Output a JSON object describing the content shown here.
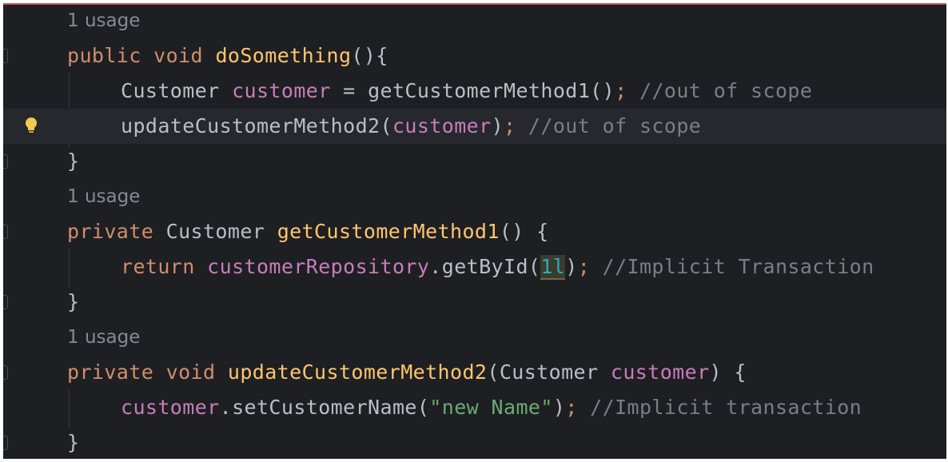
{
  "usages": [
    "1 usage",
    "1 usage",
    "1 usage"
  ],
  "method1": {
    "signature": {
      "kw1": "public",
      "kw2": "void",
      "name": "doSomething",
      "rest": "(){"
    },
    "line1": {
      "type": "Customer",
      "var": "customer",
      "op": " = ",
      "call": "getCustomerMethod1()",
      "semi": ";",
      "comment": "//out of scope"
    },
    "line2": {
      "call": "updateCustomerMethod2(",
      "arg": "customer",
      "close": ")",
      "semi": ";",
      "comment": "//out of scope"
    },
    "close": "}"
  },
  "method2": {
    "signature": {
      "kw1": "private",
      "type": "Customer",
      "name": "getCustomerMethod1",
      "rest": "() {"
    },
    "line1": {
      "kw": "return",
      "field": "customerRepository",
      "call": ".getById(",
      "num": "1l",
      "close": ")",
      "semi": ";",
      "comment": "//Implicit Transaction"
    },
    "close": "}"
  },
  "method3": {
    "signature": {
      "kw1": "private",
      "kw2": "void",
      "name": "updateCustomerMethod2",
      "open": "(",
      "ptype": "Customer",
      "param": "customer",
      "rest": ") {"
    },
    "line1": {
      "var": "customer",
      "call": ".setCustomerName(",
      "str": "\"new Name\"",
      "close": ")",
      "semi": ";",
      "comment": "//Implicit transaction"
    },
    "close": "}"
  },
  "icons": {
    "intention": "lightbulb-icon"
  },
  "colors": {
    "background": "#1e1f22",
    "keyword": "#cf8e6d",
    "method_decl": "#ffc66d",
    "field": "#c77dbb",
    "string": "#6aab73",
    "number": "#2aacb8",
    "comment": "#7a7e85",
    "top_border": "#c94f4f"
  }
}
